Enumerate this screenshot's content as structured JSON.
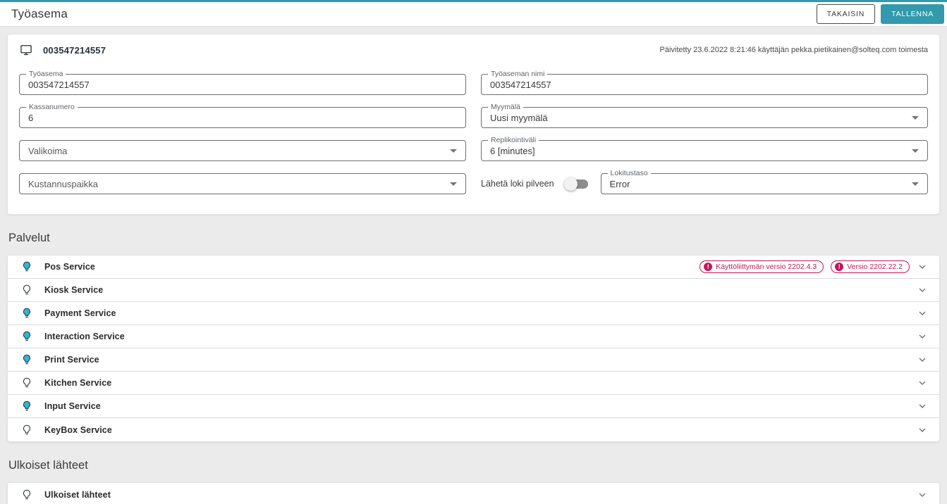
{
  "colors": {
    "accent": "#3399ac",
    "badge": "#c2185b",
    "bulb_on": "#30b7d6"
  },
  "icons": {
    "workstation": "monitor-icon",
    "service_state": "lightbulb-icon",
    "expand": "chevron-down-icon",
    "select_caret": "caret-down-icon",
    "badge_status": "error-icon"
  },
  "header": {
    "title": "Työasema",
    "back_label": "TAKAISIN",
    "save_label": "TALLENNA"
  },
  "workstation": {
    "id": "003547214557",
    "updated_text": "Päivitetty 23.6.2022 8:21:46 käyttäjän pekka.pietikainen@solteq.com toimesta"
  },
  "form": {
    "tyoasema": {
      "label": "Työasema",
      "value": "003547214557"
    },
    "tyoaseman_nimi": {
      "label": "Työaseman nimi",
      "value": "003547214557"
    },
    "kassanumero": {
      "label": "Kassanumero",
      "value": "6"
    },
    "myymala": {
      "label": "Myymälä",
      "value": "Uusi myymälä"
    },
    "valikoima": {
      "label": "Valikoima",
      "value": ""
    },
    "replikointivali": {
      "label": "Replikointiväli",
      "value": "6 [minutes]"
    },
    "kustannuspaikka": {
      "label": "Kustannuspaikka",
      "value": ""
    },
    "laheta_loki_pilveen": {
      "label": "Lähetä loki pilveen",
      "enabled": false
    },
    "lokitustaso": {
      "label": "Lokitustaso",
      "value": "Error"
    }
  },
  "services": {
    "heading": "Palvelut",
    "items": [
      {
        "name": "Pos Service",
        "active": true,
        "badges": [
          "Käyttöliittymän versio 2202.4.3",
          "Versio 2202.22.2"
        ]
      },
      {
        "name": "Kiosk Service",
        "active": false,
        "badges": []
      },
      {
        "name": "Payment Service",
        "active": true,
        "badges": []
      },
      {
        "name": "Interaction Service",
        "active": true,
        "badges": []
      },
      {
        "name": "Print Service",
        "active": true,
        "badges": []
      },
      {
        "name": "Kitchen Service",
        "active": false,
        "badges": []
      },
      {
        "name": "Input Service",
        "active": true,
        "badges": []
      },
      {
        "name": "KeyBox Service",
        "active": false,
        "badges": []
      }
    ]
  },
  "external_sources": {
    "heading": "Ulkoiset lähteet",
    "items": [
      {
        "name": "Ulkoiset lähteet",
        "active": false,
        "badges": []
      }
    ]
  }
}
